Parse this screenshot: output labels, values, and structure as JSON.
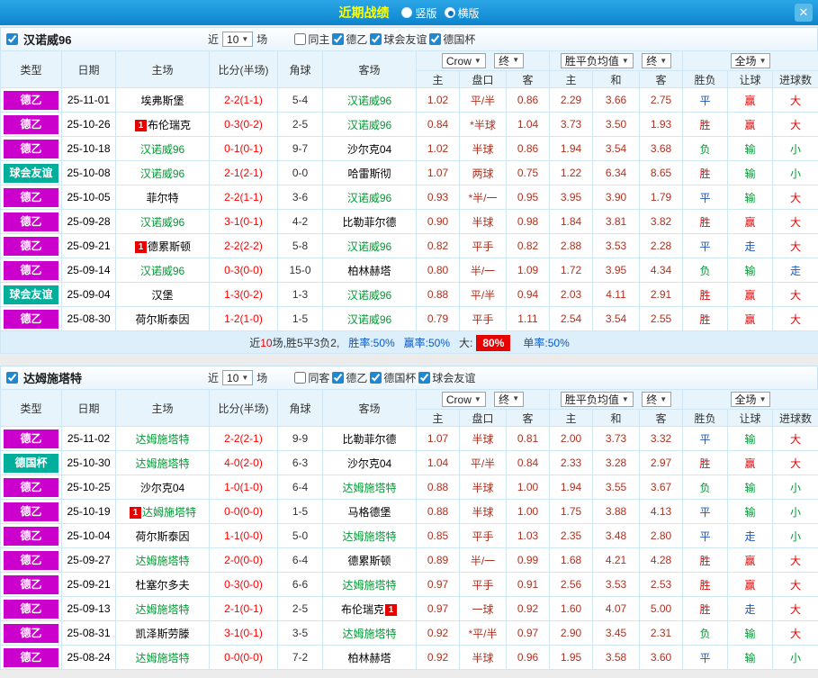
{
  "icons": {
    "dropdown_arrow": "▼",
    "close": "✕"
  },
  "topbar": {
    "title": "近期战绩",
    "radios": [
      {
        "label": "竖版",
        "selected": false
      },
      {
        "label": "横版",
        "selected": true
      }
    ]
  },
  "table_head": {
    "type": "类型",
    "date": "日期",
    "home": "主场",
    "score": "比分(半场)",
    "corner": "角球",
    "away": "客场",
    "bookmaker": "Crow",
    "final": "终",
    "avg": "胜平负均值",
    "full": "全场",
    "asian_sub": [
      "主",
      "盘口",
      "客"
    ],
    "europe_sub": [
      "主",
      "和",
      "客"
    ],
    "full_sub": [
      "胜负",
      "让球",
      "进球数"
    ]
  },
  "league_colors": {
    "德乙": "#cc00cc",
    "球会友谊": "#00af9b",
    "德国杯": "#00af9b"
  },
  "verdict_colors": {
    "胜": "#ee0000",
    "平": "#1a56c4",
    "负": "#009933",
    "赢": "#ee0000",
    "走": "#1a56c4",
    "输": "#009933",
    "大": "#ee0000",
    "小": "#009933"
  },
  "sections": [
    {
      "team": "汉诺威96",
      "checked": true,
      "filters": {
        "near_pre": "近",
        "near_value": "10",
        "near_post": "场",
        "checkboxes": [
          {
            "label": "同主",
            "checked": false
          },
          {
            "label": "德乙",
            "checked": true
          },
          {
            "label": "球会友谊",
            "checked": true
          },
          {
            "label": "德国杯",
            "checked": true
          }
        ]
      },
      "rows": [
        {
          "league": "德乙",
          "date": "25-11-01",
          "home": {
            "name": "埃弗斯堡"
          },
          "score": "2-2(1-1)",
          "corner": "5-4",
          "away": {
            "name": "汉诺威96"
          },
          "asian": [
            "1.02",
            "平/半",
            "0.86"
          ],
          "europe": [
            "2.29",
            "3.66",
            "2.75"
          ],
          "verdict": [
            "平",
            "赢",
            "大"
          ]
        },
        {
          "league": "德乙",
          "date": "25-10-26",
          "home": {
            "name": "布伦瑞克",
            "badge": "1",
            "badge_side": "left"
          },
          "score": "0-3(0-2)",
          "corner": "2-5",
          "away": {
            "name": "汉诺威96"
          },
          "asian": [
            "0.84",
            "*半球",
            "1.04"
          ],
          "europe": [
            "3.73",
            "3.50",
            "1.93"
          ],
          "verdict": [
            "胜",
            "赢",
            "大"
          ]
        },
        {
          "league": "德乙",
          "date": "25-10-18",
          "home": {
            "name": "汉诺威96"
          },
          "score": "0-1(0-1)",
          "corner": "9-7",
          "away": {
            "name": "沙尔克04"
          },
          "asian": [
            "1.02",
            "半球",
            "0.86"
          ],
          "europe": [
            "1.94",
            "3.54",
            "3.68"
          ],
          "verdict": [
            "负",
            "输",
            "小"
          ]
        },
        {
          "league": "球会友谊",
          "date": "25-10-08",
          "home": {
            "name": "汉诺威96"
          },
          "score": "2-1(2-1)",
          "corner": "0-0",
          "away": {
            "name": "哈雷斯彻"
          },
          "asian": [
            "1.07",
            "两球",
            "0.75"
          ],
          "europe": [
            "1.22",
            "6.34",
            "8.65"
          ],
          "verdict": [
            "胜",
            "输",
            "小"
          ]
        },
        {
          "league": "德乙",
          "date": "25-10-05",
          "home": {
            "name": "菲尔特"
          },
          "score": "2-2(1-1)",
          "corner": "3-6",
          "away": {
            "name": "汉诺威96"
          },
          "asian": [
            "0.93",
            "*半/一",
            "0.95"
          ],
          "europe": [
            "3.95",
            "3.90",
            "1.79"
          ],
          "verdict": [
            "平",
            "输",
            "大"
          ]
        },
        {
          "league": "德乙",
          "date": "25-09-28",
          "home": {
            "name": "汉诺威96"
          },
          "score": "3-1(0-1)",
          "corner": "4-2",
          "away": {
            "name": "比勒菲尔德"
          },
          "asian": [
            "0.90",
            "半球",
            "0.98"
          ],
          "europe": [
            "1.84",
            "3.81",
            "3.82"
          ],
          "verdict": [
            "胜",
            "赢",
            "大"
          ]
        },
        {
          "league": "德乙",
          "date": "25-09-21",
          "home": {
            "name": "德累斯顿",
            "badge": "1",
            "badge_side": "left"
          },
          "score": "2-2(2-2)",
          "corner": "5-8",
          "away": {
            "name": "汉诺威96"
          },
          "asian": [
            "0.82",
            "平手",
            "0.82"
          ],
          "europe": [
            "2.88",
            "3.53",
            "2.28"
          ],
          "verdict": [
            "平",
            "走",
            "大"
          ]
        },
        {
          "league": "德乙",
          "date": "25-09-14",
          "home": {
            "name": "汉诺威96"
          },
          "score": "0-3(0-0)",
          "corner": "15-0",
          "away": {
            "name": "柏林赫塔"
          },
          "asian": [
            "0.80",
            "半/一",
            "1.09"
          ],
          "europe": [
            "1.72",
            "3.95",
            "4.34"
          ],
          "verdict": [
            "负",
            "输",
            "走"
          ]
        },
        {
          "league": "球会友谊",
          "date": "25-09-04",
          "home": {
            "name": "汉堡"
          },
          "score": "1-3(0-2)",
          "corner": "1-3",
          "away": {
            "name": "汉诺威96"
          },
          "asian": [
            "0.88",
            "平/半",
            "0.94"
          ],
          "europe": [
            "2.03",
            "4.11",
            "2.91"
          ],
          "verdict": [
            "胜",
            "赢",
            "大"
          ]
        },
        {
          "league": "德乙",
          "date": "25-08-30",
          "home": {
            "name": "荷尔斯泰因"
          },
          "score": "1-2(1-0)",
          "corner": "1-5",
          "away": {
            "name": "汉诺威96"
          },
          "asian": [
            "0.79",
            "平手",
            "1.11"
          ],
          "europe": [
            "2.54",
            "3.54",
            "2.55"
          ],
          "verdict": [
            "胜",
            "赢",
            "大"
          ]
        }
      ],
      "summary": [
        {
          "text": "近",
          "style": "dark"
        },
        {
          "text": "10",
          "style": "red"
        },
        {
          "text": "场,胜5平3负2,",
          "style": "dark"
        },
        {
          "text": "胜率:50%",
          "style": "blue gap"
        },
        {
          "text": "赢率:50%",
          "style": "blue gap"
        },
        {
          "text": "大:",
          "style": "dark gap"
        },
        {
          "text": "80%",
          "style": "badge"
        },
        {
          "text": "单率:50%",
          "style": "blue gap"
        }
      ]
    },
    {
      "team": "达姆施塔特",
      "checked": true,
      "filters": {
        "near_pre": "近",
        "near_value": "10",
        "near_post": "场",
        "checkboxes": [
          {
            "label": "同客",
            "checked": false
          },
          {
            "label": "德乙",
            "checked": true
          },
          {
            "label": "德国杯",
            "checked": true
          },
          {
            "label": "球会友谊",
            "checked": true
          }
        ]
      },
      "rows": [
        {
          "league": "德乙",
          "date": "25-11-02",
          "home": {
            "name": "达姆施塔特"
          },
          "score": "2-2(2-1)",
          "corner": "9-9",
          "away": {
            "name": "比勒菲尔德"
          },
          "asian": [
            "1.07",
            "半球",
            "0.81"
          ],
          "europe": [
            "2.00",
            "3.73",
            "3.32"
          ],
          "verdict": [
            "平",
            "输",
            "大"
          ]
        },
        {
          "league": "德国杯",
          "date": "25-10-30",
          "home": {
            "name": "达姆施塔特"
          },
          "score": "4-0(2-0)",
          "corner": "6-3",
          "away": {
            "name": "沙尔克04"
          },
          "asian": [
            "1.04",
            "平/半",
            "0.84"
          ],
          "europe": [
            "2.33",
            "3.28",
            "2.97"
          ],
          "verdict": [
            "胜",
            "赢",
            "大"
          ]
        },
        {
          "league": "德乙",
          "date": "25-10-25",
          "home": {
            "name": "沙尔克04"
          },
          "score": "1-0(1-0)",
          "corner": "6-4",
          "away": {
            "name": "达姆施塔特"
          },
          "asian": [
            "0.88",
            "半球",
            "1.00"
          ],
          "europe": [
            "1.94",
            "3.55",
            "3.67"
          ],
          "verdict": [
            "负",
            "输",
            "小"
          ]
        },
        {
          "league": "德乙",
          "date": "25-10-19",
          "home": {
            "name": "达姆施塔特",
            "badge": "1",
            "badge_side": "left"
          },
          "score": "0-0(0-0)",
          "corner": "1-5",
          "away": {
            "name": "马格德堡"
          },
          "asian": [
            "0.88",
            "半球",
            "1.00"
          ],
          "europe": [
            "1.75",
            "3.88",
            "4.13"
          ],
          "verdict": [
            "平",
            "输",
            "小"
          ]
        },
        {
          "league": "德乙",
          "date": "25-10-04",
          "home": {
            "name": "荷尔斯泰因"
          },
          "score": "1-1(0-0)",
          "corner": "5-0",
          "away": {
            "name": "达姆施塔特"
          },
          "asian": [
            "0.85",
            "平手",
            "1.03"
          ],
          "europe": [
            "2.35",
            "3.48",
            "2.80"
          ],
          "verdict": [
            "平",
            "走",
            "小"
          ]
        },
        {
          "league": "德乙",
          "date": "25-09-27",
          "home": {
            "name": "达姆施塔特"
          },
          "score": "2-0(0-0)",
          "corner": "6-4",
          "away": {
            "name": "德累斯顿"
          },
          "asian": [
            "0.89",
            "半/一",
            "0.99"
          ],
          "europe": [
            "1.68",
            "4.21",
            "4.28"
          ],
          "verdict": [
            "胜",
            "赢",
            "大"
          ]
        },
        {
          "league": "德乙",
          "date": "25-09-21",
          "home": {
            "name": "杜塞尔多夫"
          },
          "score": "0-3(0-0)",
          "corner": "6-6",
          "away": {
            "name": "达姆施塔特"
          },
          "asian": [
            "0.97",
            "平手",
            "0.91"
          ],
          "europe": [
            "2.56",
            "3.53",
            "2.53"
          ],
          "verdict": [
            "胜",
            "赢",
            "大"
          ]
        },
        {
          "league": "德乙",
          "date": "25-09-13",
          "home": {
            "name": "达姆施塔特"
          },
          "score": "2-1(0-1)",
          "corner": "2-5",
          "away": {
            "name": "布伦瑞克",
            "badge": "1",
            "badge_side": "right"
          },
          "asian": [
            "0.97",
            "一球",
            "0.92"
          ],
          "europe": [
            "1.60",
            "4.07",
            "5.00"
          ],
          "verdict": [
            "胜",
            "走",
            "大"
          ]
        },
        {
          "league": "德乙",
          "date": "25-08-31",
          "home": {
            "name": "凯泽斯劳滕"
          },
          "score": "3-1(0-1)",
          "corner": "3-5",
          "away": {
            "name": "达姆施塔特"
          },
          "asian": [
            "0.92",
            "*平/半",
            "0.97"
          ],
          "europe": [
            "2.90",
            "3.45",
            "2.31"
          ],
          "verdict": [
            "负",
            "输",
            "大"
          ]
        },
        {
          "league": "德乙",
          "date": "25-08-24",
          "home": {
            "name": "达姆施塔特"
          },
          "score": "0-0(0-0)",
          "corner": "7-2",
          "away": {
            "name": "柏林赫塔"
          },
          "asian": [
            "0.92",
            "半球",
            "0.96"
          ],
          "europe": [
            "1.95",
            "3.58",
            "3.60"
          ],
          "verdict": [
            "平",
            "输",
            "小"
          ]
        }
      ],
      "summary": []
    }
  ]
}
